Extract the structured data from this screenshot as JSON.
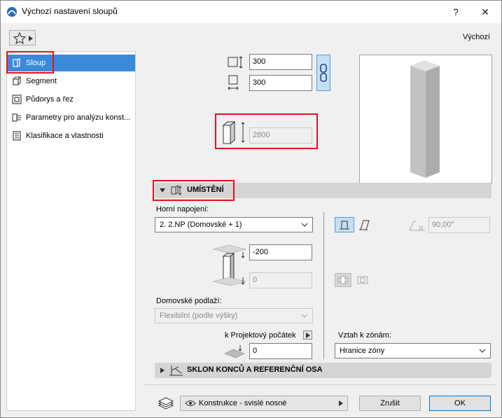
{
  "window": {
    "title": "Výchozí nastavení sloupů",
    "help_label": "?",
    "close_label": "✕",
    "defaults_label": "Výchozí"
  },
  "sidebar": {
    "items": [
      {
        "label": "Sloup",
        "icon": "column-icon",
        "selected": true
      },
      {
        "label": "Segment",
        "icon": "segment-icon",
        "selected": false
      },
      {
        "label": "Půdorys a řez",
        "icon": "floorplan-section-icon",
        "selected": false
      },
      {
        "label": "Parametry pro analýzu konst...",
        "icon": "structural-analysis-icon",
        "selected": false
      },
      {
        "label": "Klasifikace a vlastnosti",
        "icon": "classification-icon",
        "selected": false
      }
    ]
  },
  "dimensions": {
    "width": "300",
    "depth": "300",
    "height": "2800"
  },
  "placement": {
    "section_title": "UMÍSTĚNÍ",
    "top_link_label": "Horní napojení:",
    "top_link_value": "2. 2.NP (Domovské + 1)",
    "top_offset": "-200",
    "bottom_offset": "0",
    "angle": "90,00°",
    "home_story_label": "Domovské podlaží:",
    "home_story_value": "Flexibilní (podle výšky)",
    "project_zero_label": "k Projektový počátek",
    "project_zero_value": "0",
    "zone_relation_label": "Vztah k zónám:",
    "zone_relation_value": "Hranice zóny"
  },
  "slant_section": {
    "title": "SKLON KONCŮ A REFERENČNÍ OSA"
  },
  "footer": {
    "layer_value": "Konstrukce - svislé nosné",
    "cancel_label": "Zrušit",
    "ok_label": "OK"
  },
  "colors": {
    "selection": "#3b8ad9",
    "highlight": "#e8111a",
    "accent": "#0078d7"
  }
}
